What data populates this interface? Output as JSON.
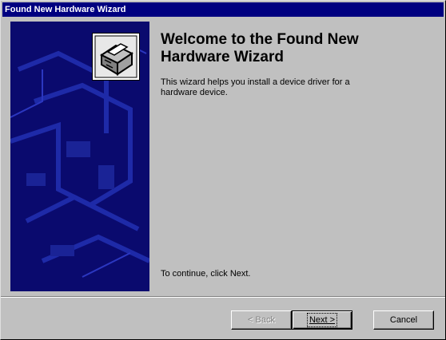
{
  "window": {
    "title": "Found New Hardware Wizard"
  },
  "main": {
    "heading": "Welcome to the Found New Hardware Wizard",
    "description": "This wizard helps you install a device driver for a hardware device.",
    "continue_text": "To continue, click Next."
  },
  "buttons": {
    "back_label": "< Back",
    "next_label": "Next >",
    "cancel_label": "Cancel"
  },
  "colors": {
    "titlebar": "#000080",
    "banner": "#0a0a6e",
    "window_face": "#c0c0c0"
  },
  "icons": {
    "wizard": "hardware-wizard-icon"
  }
}
